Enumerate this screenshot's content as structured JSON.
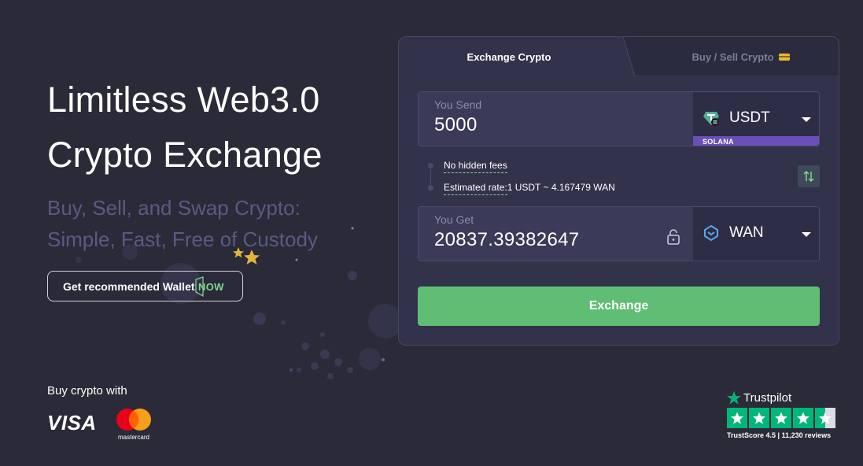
{
  "hero": {
    "title_line1": "Limitless Web3.0",
    "title_line2": "Crypto Exchange",
    "sub_line1": "Buy, Sell, and Swap Crypto:",
    "sub_line2": "Simple, Fast, Free of Custody"
  },
  "wallet_button": {
    "label": "Get recommended Wallet",
    "badge": "NOW"
  },
  "payments": {
    "heading": "Buy crypto with",
    "visa": "VISA",
    "mastercard": "mastercard"
  },
  "trustpilot": {
    "name": "Trustpilot",
    "score_text": "TrustScore 4.5  |  11,230 reviews",
    "rating": 4.5
  },
  "exchange": {
    "tabs": [
      {
        "label": "Exchange Crypto",
        "active": true
      },
      {
        "label": "Buy / Sell Crypto",
        "active": false
      }
    ],
    "send": {
      "label": "You Send",
      "value": "5000",
      "currency": "USDT",
      "network": "SOLANA",
      "icon": "tether-icon"
    },
    "info": {
      "fees": "No hidden fees",
      "rate_label": "Estimated rate:",
      "rate_value": "1 USDT ~ 4.167479 WAN"
    },
    "get": {
      "label": "You Get",
      "value": "20837.39382647",
      "currency": "WAN",
      "icon": "wanchain-icon"
    },
    "submit_label": "Exchange"
  },
  "colors": {
    "background": "#2a2a38",
    "accent_green": "#5fbe73",
    "network_purple": "#6a4fb8",
    "subtitle": "#5a5a82"
  }
}
